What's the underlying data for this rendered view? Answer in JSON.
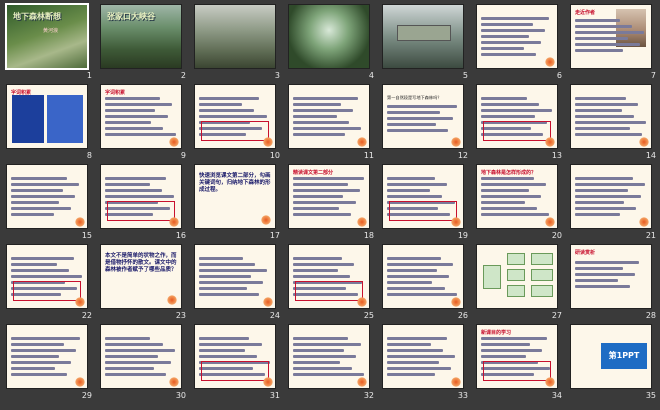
{
  "window": {
    "title": "地下森林断想"
  },
  "colors": {
    "background": "#3a3a3a",
    "accent": "#c8102e",
    "number_text": "#e8e8e8",
    "slide_blue": "#1c3f9c"
  },
  "selected_slide": 1,
  "slides": [
    {
      "n": "1",
      "kind": "title",
      "title": "地下森林断想",
      "sub": "黄河浪"
    },
    {
      "n": "2",
      "kind": "pic",
      "title": "张家口大峡谷"
    },
    {
      "n": "3",
      "kind": "pic",
      "title": ""
    },
    {
      "n": "4",
      "kind": "pic",
      "title": ""
    },
    {
      "n": "5",
      "kind": "pic",
      "title": ""
    },
    {
      "n": "6",
      "kind": "text",
      "heading": "",
      "body": ""
    },
    {
      "n": "7",
      "kind": "photo",
      "heading": "走近作者",
      "body": ""
    },
    {
      "n": "8",
      "kind": "blue",
      "heading": "字词积累",
      "body": ""
    },
    {
      "n": "9",
      "kind": "text",
      "heading": "字词积累",
      "body": ""
    },
    {
      "n": "10",
      "kind": "text",
      "heading": "",
      "body": ""
    },
    {
      "n": "11",
      "kind": "text",
      "heading": "",
      "body": ""
    },
    {
      "n": "12",
      "kind": "text",
      "heading": "",
      "body": "第一自然段是写地下森林吗？"
    },
    {
      "n": "13",
      "kind": "text",
      "heading": "",
      "body": ""
    },
    {
      "n": "14",
      "kind": "text",
      "heading": "",
      "body": ""
    },
    {
      "n": "15",
      "kind": "text",
      "heading": "",
      "body": ""
    },
    {
      "n": "16",
      "kind": "text",
      "heading": "",
      "body": ""
    },
    {
      "n": "17",
      "kind": "big",
      "heading": "",
      "body": "快速浏览课文第二部分，勾画关键词句，归纳地下森林的形成过程。"
    },
    {
      "n": "18",
      "kind": "text",
      "heading": "精读课文第二部分",
      "body": ""
    },
    {
      "n": "19",
      "kind": "text",
      "heading": "",
      "body": ""
    },
    {
      "n": "20",
      "kind": "text",
      "heading": "地下森林是怎样形成的？",
      "body": ""
    },
    {
      "n": "21",
      "kind": "text",
      "heading": "",
      "body": ""
    },
    {
      "n": "22",
      "kind": "text",
      "heading": "",
      "body": ""
    },
    {
      "n": "23",
      "kind": "big",
      "heading": "",
      "body": "本文不是简单的状物之作，而是借物抒怀的散文。课文中的森林被作者赋予了哪些品质？"
    },
    {
      "n": "24",
      "kind": "text",
      "heading": "",
      "body": ""
    },
    {
      "n": "25",
      "kind": "text",
      "heading": "",
      "body": ""
    },
    {
      "n": "26",
      "kind": "text",
      "heading": "",
      "body": ""
    },
    {
      "n": "27",
      "kind": "diagram",
      "heading": "",
      "body": ""
    },
    {
      "n": "28",
      "kind": "study",
      "heading": "研读赏析",
      "body": ""
    },
    {
      "n": "29",
      "kind": "text",
      "heading": "",
      "body": ""
    },
    {
      "n": "30",
      "kind": "text",
      "heading": "",
      "body": ""
    },
    {
      "n": "31",
      "kind": "text",
      "heading": "",
      "body": ""
    },
    {
      "n": "32",
      "kind": "text",
      "heading": "",
      "body": ""
    },
    {
      "n": "33",
      "kind": "text",
      "heading": "",
      "body": ""
    },
    {
      "n": "34",
      "kind": "text",
      "heading": "新课目的学习",
      "body": ""
    },
    {
      "n": "35",
      "kind": "logo",
      "heading": "",
      "body": "第1PPT"
    }
  ]
}
